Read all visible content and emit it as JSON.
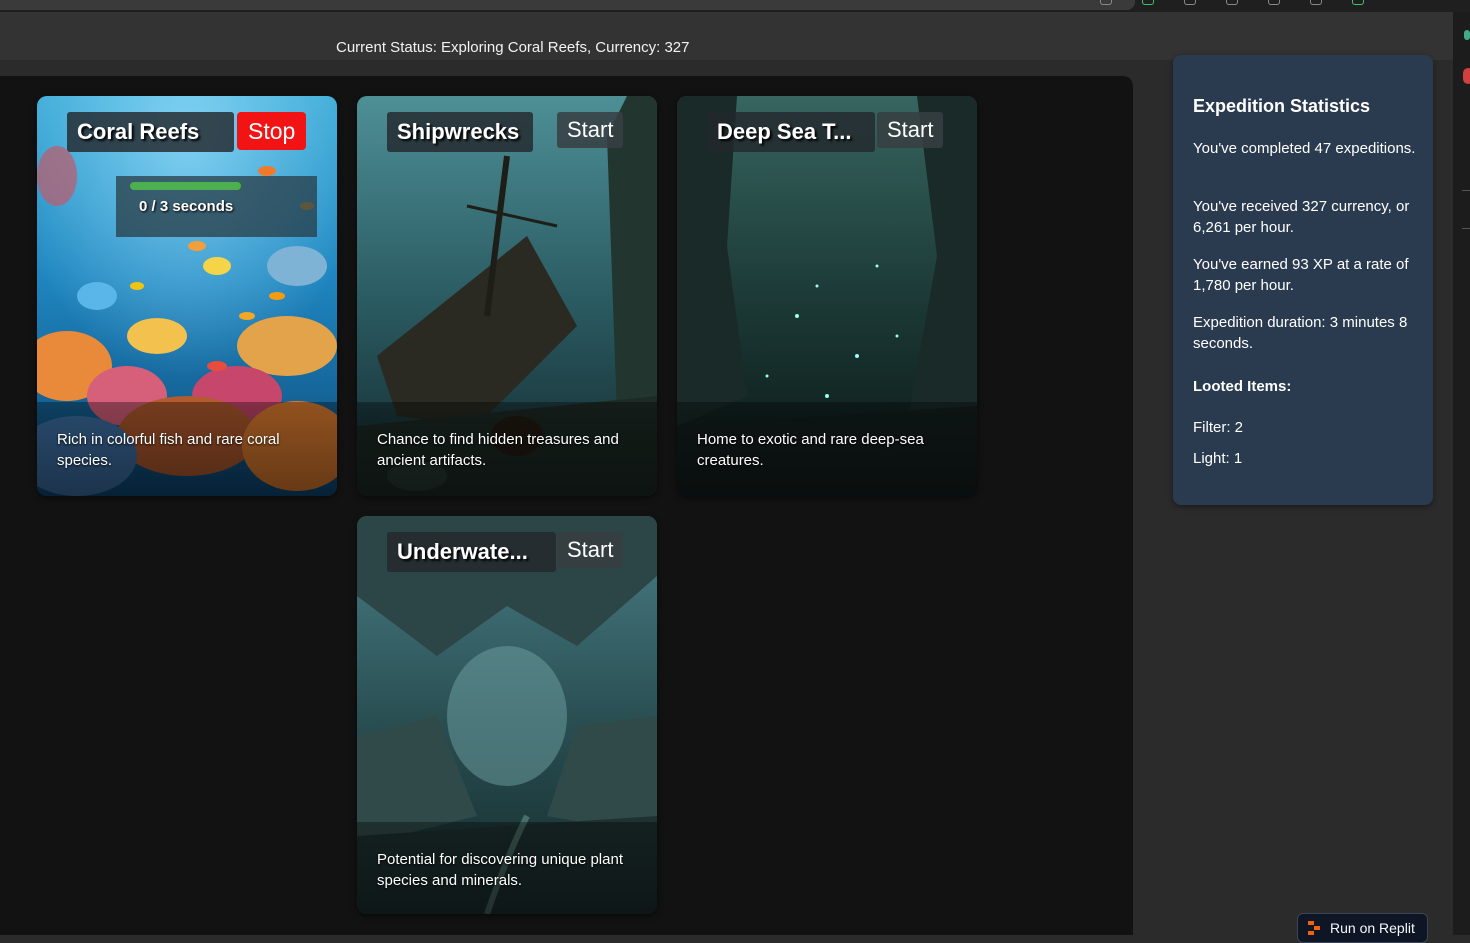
{
  "status": {
    "text": "Current Status: Exploring Coral Reefs, Currency: 327"
  },
  "expeditions": [
    {
      "title": "Coral Reefs",
      "button": "Stop",
      "state": "active",
      "description": "Rich in colorful fish and rare coral species.",
      "progress": {
        "label": "0 / 3 seconds",
        "current": 0,
        "total": 3,
        "bar_fill_fraction": 0.99
      }
    },
    {
      "title": "Shipwrecks",
      "button": "Start",
      "state": "idle",
      "description": "Chance to find hidden treasures and ancient artifacts."
    },
    {
      "title": "Deep Sea T...",
      "button": "Start",
      "state": "idle",
      "description": "Home to exotic and rare deep-sea creatures."
    },
    {
      "title": "Underwate...",
      "button": "Start",
      "state": "idle",
      "description": "Potential for discovering unique plant species and minerals."
    }
  ],
  "stats": {
    "title": "Expedition Statistics",
    "completed": "You've completed 47 expeditions.",
    "currency": "You've received 327 currency, or 6,261 per hour.",
    "xp": "You've earned 93 XP at a rate of 1,780 per hour.",
    "duration": "Expedition duration: 3 minutes 8 seconds.",
    "looted_heading": "Looted Items:",
    "items": [
      "Filter: 2",
      "Light: 1"
    ]
  },
  "replit": {
    "label": "Run on Replit",
    "icon": "replit-logo-icon"
  },
  "colors": {
    "stop_button": "#f21414",
    "stats_panel": "#2a3a4f",
    "progress_fill": "#4caf50",
    "main_background": "#121212"
  }
}
